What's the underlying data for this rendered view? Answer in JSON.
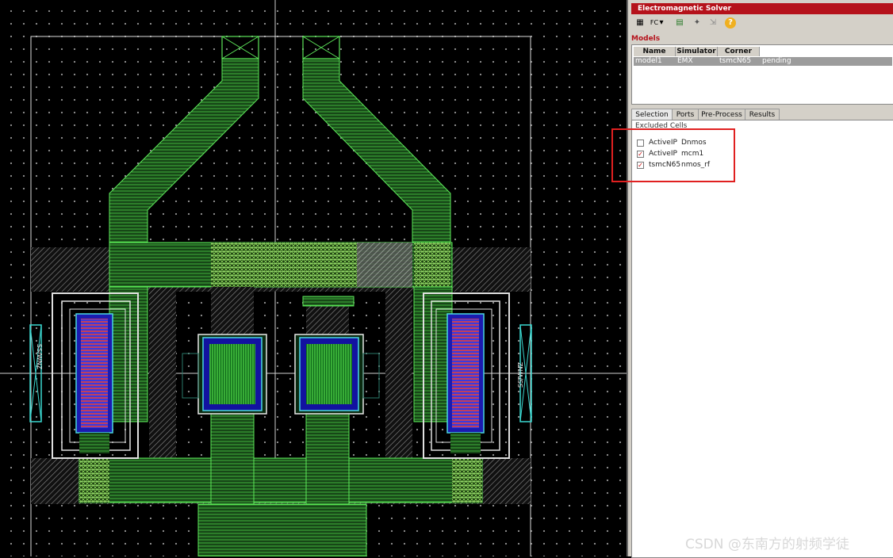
{
  "layout_view": {
    "device_labels": [
      "SS/WNZ",
      "SS/WNZ"
    ]
  },
  "panel": {
    "title": "Electromagnetic Solver",
    "toolbar": {
      "buttons": [
        {
          "name": "new-model-icon",
          "glyph": "▦"
        },
        {
          "name": "fc-icon",
          "glyph": "FC"
        },
        {
          "name": "dropdown-arrow-icon",
          "glyph": "▾"
        },
        {
          "name": "grid-icon",
          "glyph": "▤"
        },
        {
          "name": "run-icon",
          "glyph": "✦"
        },
        {
          "name": "export-icon",
          "glyph": "⇲"
        },
        {
          "name": "help-icon",
          "glyph": "?"
        }
      ]
    },
    "models": {
      "label": "Models",
      "columns": [
        "Name",
        "Simulator",
        "Corner"
      ],
      "rows": [
        {
          "name": "model1",
          "simulator": "EMX",
          "corner": "tsmcN65",
          "status": "pending"
        }
      ]
    },
    "tabs": [
      "Selection",
      "Ports",
      "Pre-Process",
      "Results"
    ],
    "selection": {
      "header": "Excluded Cells",
      "cells": [
        {
          "library": "ActiveIP",
          "cell": "Dnmos",
          "checked": false
        },
        {
          "library": "ActiveIP",
          "cell": "mcm1",
          "checked": true
        },
        {
          "library": "tsmcN65",
          "cell": "nmos_rf",
          "checked": true
        }
      ]
    }
  },
  "watermark": "CSDN @东南方的射频学徒"
}
